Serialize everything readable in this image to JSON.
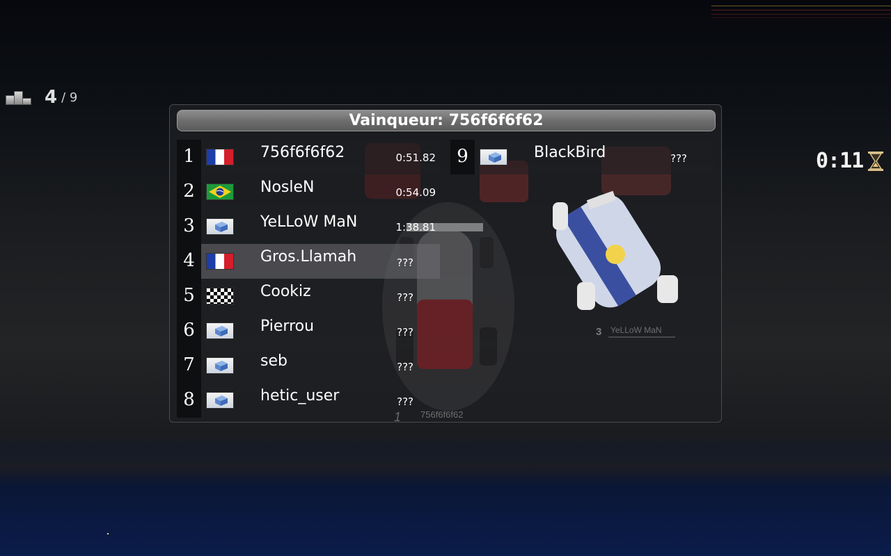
{
  "rank": {
    "position": "4",
    "separator_total": "/ 9"
  },
  "timer": {
    "text": "0:11"
  },
  "results": {
    "title": "Vainqueur: 756f6f6f62",
    "rows": [
      {
        "pos": "1",
        "flag": "flag-france-icon",
        "name": "756f6f6f62",
        "time": "0:51.82"
      },
      {
        "pos": "2",
        "flag": "flag-brazil-icon",
        "name": "NosleN",
        "time": "0:54.09"
      },
      {
        "pos": "3",
        "flag": "generic-player-icon",
        "name": "YeLLoW MaN",
        "time": "1:38.81"
      },
      {
        "pos": "4",
        "flag": "flag-france-icon",
        "name": "Gros.Llamah",
        "time": "???"
      },
      {
        "pos": "5",
        "flag": "checkered-flag-icon",
        "name": "Cookiz",
        "time": "???"
      },
      {
        "pos": "6",
        "flag": "generic-player-icon",
        "name": "Pierrou",
        "time": "???"
      },
      {
        "pos": "7",
        "flag": "generic-player-icon",
        "name": "seb",
        "time": "???"
      },
      {
        "pos": "8",
        "flag": "generic-player-icon",
        "name": "hetic_user",
        "time": "???"
      },
      {
        "pos": "9",
        "flag": "generic-player-icon",
        "name": "BlackBird",
        "time": "???"
      }
    ]
  },
  "background_labels": {
    "kart_3": "YeLLoW MaN",
    "kart_3_num": "3",
    "kart_1": "756f6f6f62",
    "kart_1_num": "1"
  },
  "colors": {
    "panel_bg": "#1e1f22",
    "title_bar": "#6e6e6e",
    "highlight_row": "#6e6e73",
    "bottom_glow": "#0a1c4a"
  }
}
